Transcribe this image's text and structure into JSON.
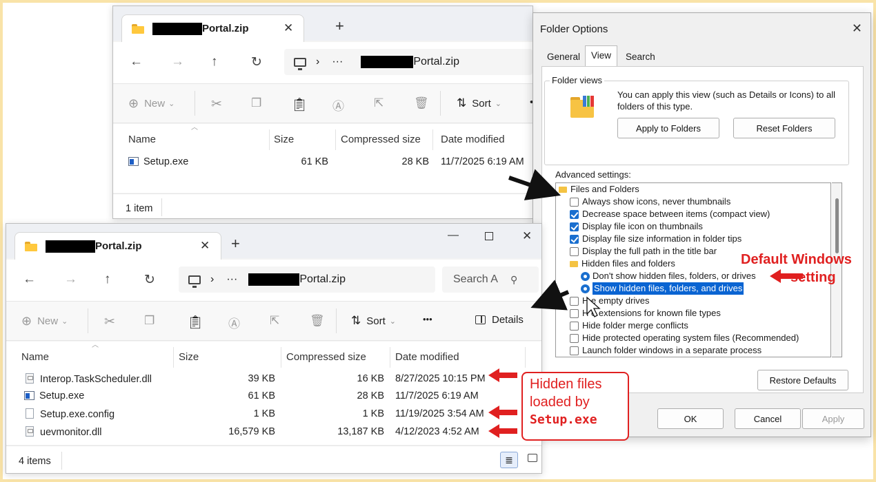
{
  "top_explorer": {
    "tab_title": "Portal.zip",
    "address": "Portal.zip",
    "toolbar": {
      "new": "New",
      "sort": "Sort"
    },
    "columns": [
      "Name",
      "Size",
      "Compressed size",
      "Date modified"
    ],
    "rows": [
      {
        "name": "Setup.exe",
        "size": "61 KB",
        "compressed": "28 KB",
        "date": "11/7/2025 6:19 AM",
        "icon": "exe-icon"
      }
    ],
    "status": "1 item"
  },
  "bottom_explorer": {
    "tab_title": "Portal.zip",
    "address": "Portal.zip",
    "search_placeholder": "Search A",
    "toolbar": {
      "new": "New",
      "sort": "Sort",
      "more": "•••",
      "details": "Details"
    },
    "columns": [
      "Name",
      "Size",
      "Compressed size",
      "Date modified"
    ],
    "rows": [
      {
        "name": "Interop.TaskScheduler.dll",
        "size": "39 KB",
        "compressed": "16 KB",
        "date": "8/27/2025 10:15 PM",
        "icon": "dll-icon"
      },
      {
        "name": "Setup.exe",
        "size": "61 KB",
        "compressed": "28 KB",
        "date": "11/7/2025 6:19 AM",
        "icon": "exe-icon"
      },
      {
        "name": "Setup.exe.config",
        "size": "1 KB",
        "compressed": "1 KB",
        "date": "11/19/2025 3:54 AM",
        "icon": "file-icon"
      },
      {
        "name": "uevmonitor.dll",
        "size": "16,579 KB",
        "compressed": "13,187 KB",
        "date": "4/12/2023 4:52 AM",
        "icon": "dll-icon"
      }
    ],
    "status": "4 items"
  },
  "folder_options": {
    "title": "Folder Options",
    "tabs": [
      "General",
      "View",
      "Search"
    ],
    "active_tab": "View",
    "folder_views_label": "Folder views",
    "folder_views_text": "You can apply this view (such as Details or Icons) to all folders of this type.",
    "apply_button": "Apply to Folders",
    "reset_button": "Reset Folders",
    "advanced_label": "Advanced settings:",
    "tree": [
      {
        "type": "folder",
        "label": "Files and Folders"
      },
      {
        "type": "checkbox",
        "checked": false,
        "label": "Always show icons, never thumbnails"
      },
      {
        "type": "checkbox",
        "checked": true,
        "label": "Decrease space between items (compact view)"
      },
      {
        "type": "checkbox",
        "checked": true,
        "label": "Display file icon on thumbnails"
      },
      {
        "type": "checkbox",
        "checked": true,
        "label": "Display file size information in folder tips"
      },
      {
        "type": "checkbox",
        "checked": false,
        "label": "Display the full path in the title bar"
      },
      {
        "type": "folder",
        "label": "Hidden files and folders"
      },
      {
        "type": "radio",
        "label": "Don't show hidden files, folders, or drives"
      },
      {
        "type": "radio",
        "label": "Show hidden files, folders, and drives",
        "selected": true
      },
      {
        "type": "checkbox",
        "checked": false,
        "label": "H  e empty drives"
      },
      {
        "type": "checkbox",
        "checked": false,
        "label": "H  e extensions for known file types"
      },
      {
        "type": "checkbox",
        "checked": false,
        "label": "Hide folder merge conflicts"
      },
      {
        "type": "checkbox",
        "checked": false,
        "label": "Hide protected operating system files (Recommended)"
      },
      {
        "type": "checkbox",
        "checked": false,
        "label": "Launch folder windows in a separate process"
      }
    ],
    "restore_button": "Restore Defaults",
    "ok_button": "OK",
    "cancel_button": "Cancel",
    "apply_disabled": "Apply"
  },
  "annotations": {
    "default_line1": "Default Windows",
    "default_line2": "setting",
    "hidden_line1": "Hidden files",
    "hidden_line2": "loaded by",
    "hidden_line3": "Setup.exe",
    "color": "#e02020"
  }
}
